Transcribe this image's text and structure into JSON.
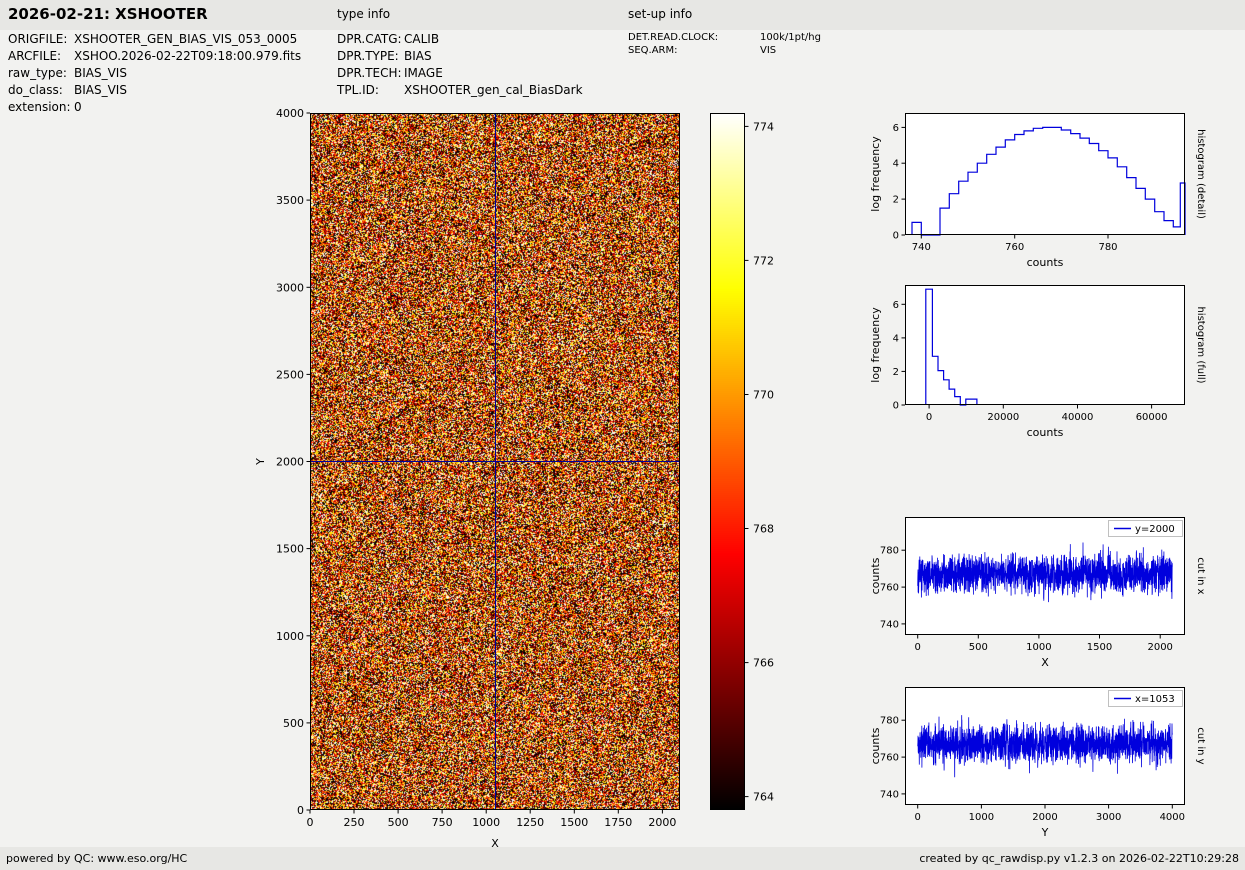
{
  "header": {
    "title": "2026-02-21: XSHOOTER",
    "type_info_heading": "type info",
    "setup_info_heading": "set-up info"
  },
  "file_info": {
    "rows": [
      {
        "label": "ORIGFILE:",
        "value": "XSHOOTER_GEN_BIAS_VIS_053_0005"
      },
      {
        "label": "ARCFILE:",
        "value": "XSHOO.2026-02-22T09:18:00.979.fits"
      },
      {
        "label": "raw_type:",
        "value": "BIAS_VIS"
      },
      {
        "label": "do_class:",
        "value": "BIAS_VIS"
      },
      {
        "label": "extension:",
        "value": "0"
      }
    ]
  },
  "type_info": {
    "rows": [
      {
        "label": "DPR.CATG:",
        "value": "CALIB"
      },
      {
        "label": "DPR.TYPE:",
        "value": "BIAS"
      },
      {
        "label": "DPR.TECH:",
        "value": "IMAGE"
      },
      {
        "label": "TPL.ID:",
        "value": "XSHOOTER_gen_cal_BiasDark"
      }
    ]
  },
  "setup_info": {
    "rows": [
      {
        "label": "DET.READ.CLOCK:",
        "value": "100k/1pt/hg"
      },
      {
        "label": "SEQ.ARM:",
        "value": "VIS"
      }
    ]
  },
  "footer": {
    "left": "powered by QC: www.eso.org/HC",
    "right": "created by qc_rawdisp.py v1.2.3 on 2026-02-22T10:29:28"
  },
  "colors": {
    "plot_line": "#0000dd",
    "crosshair": "#000099",
    "header_bar": "#e7e7e4",
    "page_background": "#f2f2f0"
  },
  "chart_data": [
    {
      "id": "bias_image",
      "type": "heatmap",
      "description": "raw bias frame: gaussian read noise displayed with hot colormap",
      "xlabel": "X",
      "ylabel": "Y",
      "xlim": [
        0,
        2100
      ],
      "ylim": [
        0,
        4000
      ],
      "x_ticks": [
        0,
        250,
        500,
        750,
        1000,
        1250,
        1500,
        1750,
        2000
      ],
      "y_ticks": [
        0,
        500,
        1000,
        1500,
        2000,
        2500,
        3000,
        3500,
        4000
      ],
      "colormap": "hot",
      "vmin": 763.8,
      "vmax": 774.2,
      "noise_mean": 768,
      "noise_std": 5,
      "colorbar_ticks": [
        764,
        766,
        768,
        770,
        772,
        774
      ],
      "crosshair": {
        "x": 1053,
        "y": 2000,
        "color": "#000099"
      }
    },
    {
      "id": "hist_detail",
      "type": "histogram",
      "right_label": "histogram (detail)",
      "xlabel": "counts",
      "ylabel": "log frequency",
      "xlim": [
        736.5,
        796.5
      ],
      "ylim": [
        0,
        6.8
      ],
      "x_ticks": [
        740,
        760,
        780
      ],
      "y_ticks": [
        0,
        2,
        4,
        6
      ],
      "line_color": "#0000dd",
      "bin_edges": [
        738,
        740,
        742,
        744,
        746,
        748,
        750,
        752,
        754,
        756,
        758,
        760,
        762,
        764,
        766,
        768,
        770,
        772,
        774,
        776,
        778,
        780,
        782,
        784,
        786,
        788,
        790,
        792,
        794,
        795.5,
        796.5
      ],
      "heights": [
        0.7,
        0,
        0,
        1.5,
        2.3,
        3.0,
        3.5,
        4.0,
        4.5,
        4.9,
        5.3,
        5.6,
        5.8,
        5.95,
        6.0,
        6.0,
        5.85,
        5.65,
        5.4,
        5.1,
        4.7,
        4.3,
        3.8,
        3.2,
        2.6,
        2.0,
        1.3,
        0.8,
        0.45,
        2.9
      ]
    },
    {
      "id": "hist_full",
      "type": "histogram",
      "right_label": "histogram (full)",
      "xlabel": "counts",
      "ylabel": "log frequency",
      "xlim": [
        -6500,
        69000
      ],
      "ylim": [
        0,
        7.15
      ],
      "x_ticks": [
        0,
        20000,
        40000,
        60000
      ],
      "y_ticks": [
        0,
        2,
        4,
        6
      ],
      "line_color": "#0000dd",
      "bin_edges": [
        -900,
        900,
        2400,
        3900,
        5400,
        6900,
        8400,
        9900,
        12900
      ],
      "heights": [
        6.9,
        2.9,
        2.05,
        1.5,
        0.95,
        0.5,
        0,
        0.35
      ]
    },
    {
      "id": "cut_x",
      "type": "line",
      "right_label": "cut in x",
      "legend": "y=2000",
      "xlabel": "X",
      "ylabel": "counts",
      "xlim": [
        -105,
        2205
      ],
      "ylim": [
        734,
        798
      ],
      "x_ticks": [
        0,
        500,
        1000,
        1500,
        2000
      ],
      "y_ticks": [
        740,
        760,
        780
      ],
      "line_color": "#0000dd",
      "n_points": 2100,
      "x_max": 2100,
      "mean": 767,
      "std": 5
    },
    {
      "id": "cut_y",
      "type": "line",
      "right_label": "cut in y",
      "legend": "x=1053",
      "xlabel": "Y",
      "ylabel": "counts",
      "xlim": [
        -200,
        4200
      ],
      "ylim": [
        734,
        798
      ],
      "x_ticks": [
        0,
        1000,
        2000,
        3000,
        4000
      ],
      "y_ticks": [
        740,
        760,
        780
      ],
      "line_color": "#0000dd",
      "n_points": 2000,
      "x_max": 4000,
      "mean": 767,
      "std": 5
    }
  ]
}
